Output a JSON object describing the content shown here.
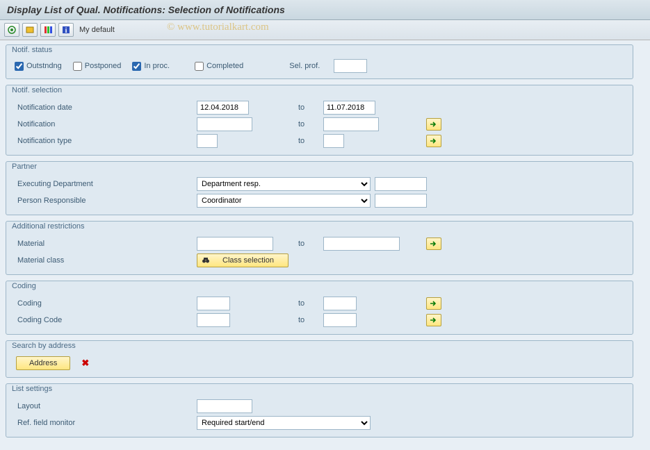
{
  "title": "Display List of Qual. Notifications: Selection of Notifications",
  "toolbar": {
    "my_default": "My default"
  },
  "watermark": "© www.tutorialkart.com",
  "groups": {
    "status": {
      "title": "Notif. status",
      "outstanding": "Outstndng",
      "postponed": "Postponed",
      "in_process": "In proc.",
      "completed": "Completed",
      "sel_prof": "Sel. prof."
    },
    "selection": {
      "title": "Notif. selection",
      "date_lbl": "Notification date",
      "date_from": "12.04.2018",
      "date_to": "11.07.2018",
      "notif_lbl": "Notification",
      "type_lbl": "Notification type",
      "to": "to"
    },
    "partner": {
      "title": "Partner",
      "dept_lbl": "Executing Department",
      "dept_sel": "Department resp.",
      "person_lbl": "Person Responsible",
      "person_sel": "Coordinator"
    },
    "additional": {
      "title": "Additional restrictions",
      "material_lbl": "Material",
      "matclass_lbl": "Material class",
      "class_btn": "Class selection",
      "to": "to"
    },
    "coding": {
      "title": "Coding",
      "coding_lbl": "Coding",
      "code_lbl": "Coding Code",
      "to": "to"
    },
    "address": {
      "title": "Search by address",
      "btn": "Address"
    },
    "list": {
      "title": "List settings",
      "layout_lbl": "Layout",
      "ref_lbl": "Ref. field monitor",
      "ref_sel": "Required start/end"
    }
  }
}
